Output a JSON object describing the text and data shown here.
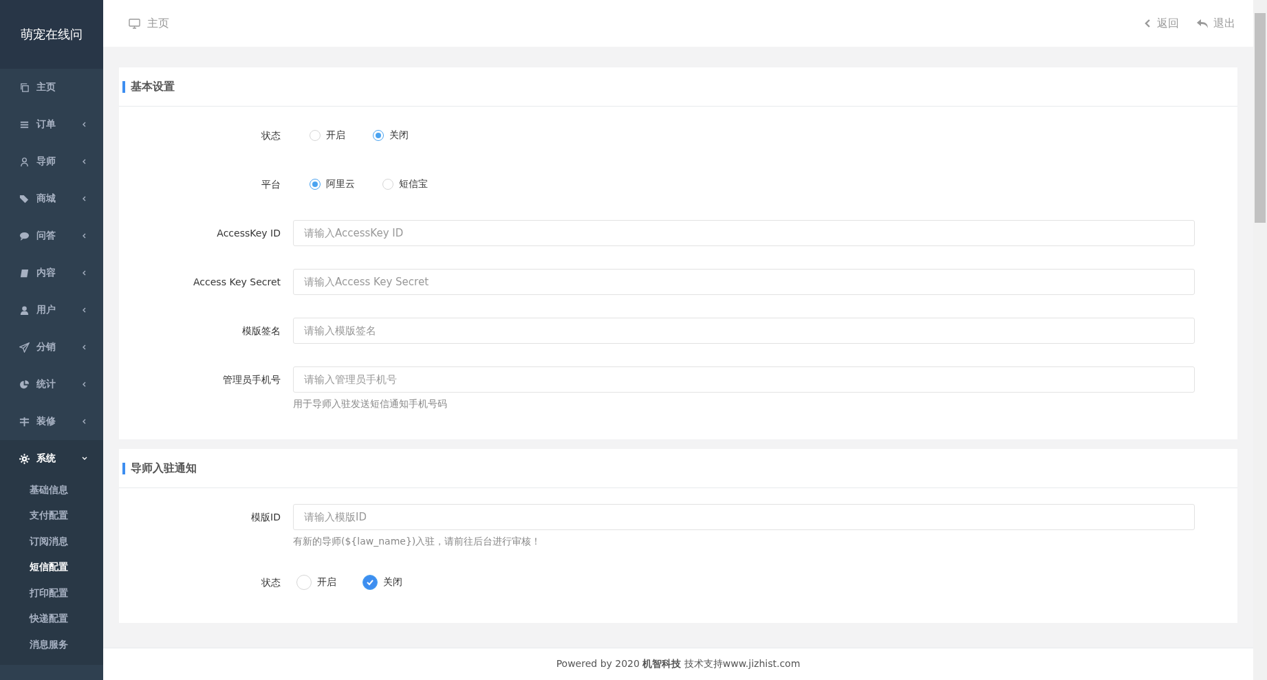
{
  "sidebar": {
    "logo": "萌宠在线问",
    "items": [
      {
        "kind": "link",
        "label": "主页"
      },
      {
        "kind": "menu",
        "label": "订单",
        "expanded": false
      },
      {
        "kind": "menu",
        "label": "导师",
        "expanded": false
      },
      {
        "kind": "menu",
        "label": "商城",
        "expanded": false
      },
      {
        "kind": "menu",
        "label": "问答",
        "expanded": false
      },
      {
        "kind": "menu",
        "label": "内容",
        "expanded": false
      },
      {
        "kind": "menu",
        "label": "用户",
        "expanded": false
      },
      {
        "kind": "menu",
        "label": "分销",
        "expanded": false
      },
      {
        "kind": "menu",
        "label": "统计",
        "expanded": false
      },
      {
        "kind": "menu",
        "label": "装修",
        "expanded": false
      },
      {
        "kind": "menu",
        "label": "系统",
        "expanded": true,
        "children": [
          {
            "label": "基础信息",
            "selected": false
          },
          {
            "label": "支付配置",
            "selected": false
          },
          {
            "label": "订阅消息",
            "selected": false
          },
          {
            "label": "短信配置",
            "selected": true
          },
          {
            "label": "打印配置",
            "selected": false
          },
          {
            "label": "快递配置",
            "selected": false
          },
          {
            "label": "消息服务",
            "selected": false
          }
        ]
      }
    ]
  },
  "header": {
    "breadcrumb": "主页",
    "actions": [
      {
        "kind": "back",
        "label": "返回"
      },
      {
        "kind": "logout",
        "label": "退出"
      }
    ]
  },
  "sections": [
    {
      "title": "基本设置",
      "fields": [
        {
          "kind": "radio",
          "label": "状态",
          "options": [
            {
              "label": "开启",
              "selected": false
            },
            {
              "label": "关闭",
              "selected": true
            }
          ]
        },
        {
          "kind": "radio",
          "label": "平台",
          "options": [
            {
              "label": "阿里云",
              "selected": true
            },
            {
              "label": "短信宝",
              "selected": false
            }
          ]
        },
        {
          "kind": "input",
          "label": "AccessKey ID",
          "placeholder": "请输入AccessKey ID"
        },
        {
          "kind": "input",
          "label": "Access Key Secret",
          "placeholder": "请输入Access Key Secret"
        },
        {
          "kind": "input",
          "label": "模版签名",
          "placeholder": "请输入模版签名"
        },
        {
          "kind": "input",
          "label": "管理员手机号",
          "placeholder": "请输入管理员手机号",
          "hint": "用于导师入驻发送短信通知手机号码"
        }
      ]
    },
    {
      "title": "导师入驻通知",
      "fields": [
        {
          "kind": "input",
          "label": "模版ID",
          "placeholder": "请输入模版ID",
          "hint": "有新的导师(${law_name})入驻，请前往后台进行审核！"
        },
        {
          "kind": "checkradio",
          "label": "状态",
          "options": [
            {
              "label": "开启",
              "selected": false
            },
            {
              "label": "关闭",
              "selected": true
            }
          ]
        }
      ]
    }
  ],
  "footer": "Powered by 2020 **机智科技** 技术支持www.jizhist.com"
}
